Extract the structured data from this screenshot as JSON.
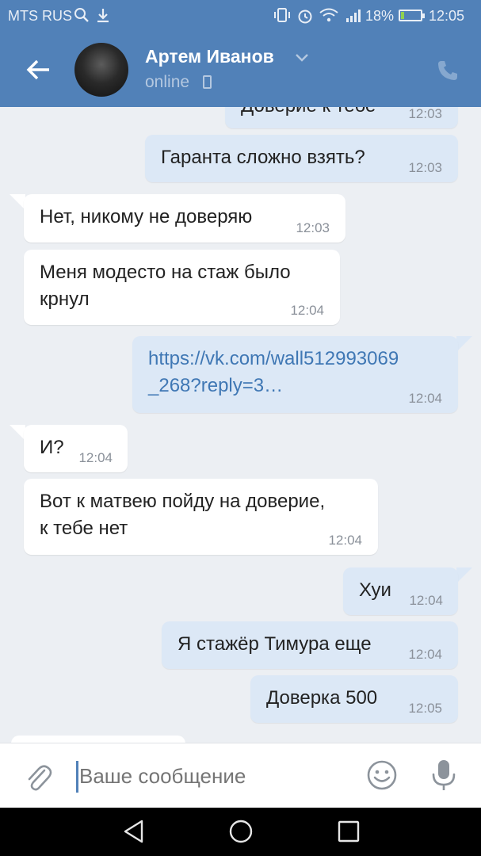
{
  "status_bar": {
    "carrier": "MTS RUS",
    "battery": "18%",
    "battery_level": 0.18,
    "time": "12:05"
  },
  "header": {
    "contact_name": "Артем Иванов",
    "presence": "online"
  },
  "messages": [
    {
      "dir": "out",
      "text": "Доверие к тебе",
      "time": "12:03"
    },
    {
      "dir": "out",
      "text": "Гаранта сложно взять?",
      "time": "12:03"
    },
    {
      "dir": "in",
      "text": "Нет, никому не доверяю",
      "time": "12:03"
    },
    {
      "dir": "in",
      "text_line1": "Меня модесто на стаж было",
      "text_line2": "крнул",
      "time": "12:04"
    },
    {
      "dir": "out",
      "text_line1": "https://vk.com/wall512993069",
      "text_line2": "_268?reply=3…",
      "time": "12:04"
    },
    {
      "dir": "in",
      "text": "И?",
      "time": "12:04"
    },
    {
      "dir": "in",
      "text_line1": "Вот к матвею пойду на доверие,",
      "text_line2": "к тебе нет",
      "time": "12:04"
    },
    {
      "dir": "out",
      "text": "Хуи",
      "time": "12:04"
    },
    {
      "dir": "out",
      "text": "Я стажёр Тимура еще",
      "time": "12:04"
    },
    {
      "dir": "out",
      "text": "Доверка 500",
      "time": "12:05"
    }
  ],
  "composer": {
    "placeholder": "Ваше сообщение"
  },
  "icons": {
    "search": "search-icon",
    "download": "download-icon",
    "back": "back-arrow-icon",
    "call": "phone-icon",
    "attach": "paperclip-icon",
    "emoji": "smile-icon",
    "mic": "microphone-icon"
  },
  "colors": {
    "header": "#5181b8",
    "outgoing_bubble": "#dce8f6",
    "incoming_bubble": "#ffffff",
    "background": "#eceff3"
  }
}
